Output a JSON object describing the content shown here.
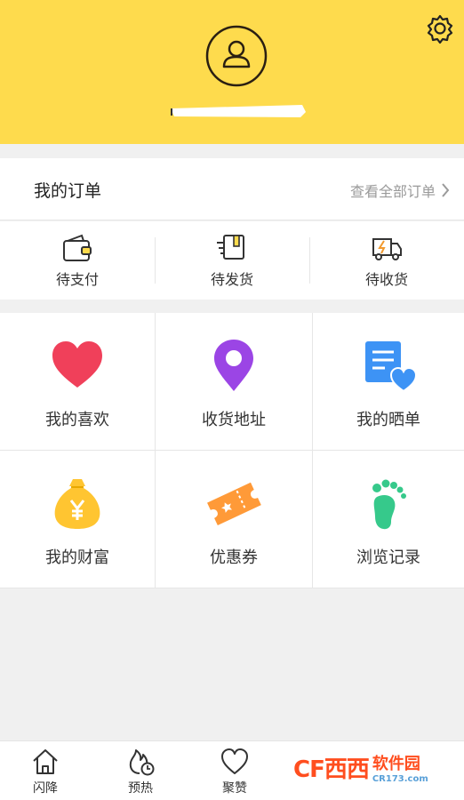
{
  "colors": {
    "header_bg": "#fedb4d",
    "heart": "#f0405a",
    "pin": "#9b45e5",
    "doc": "#3d93f5",
    "bag": "#ffc531",
    "ticket": "#ff9a38",
    "foot": "#36c98b",
    "watermark": "#ff4e1f"
  },
  "header": {
    "settings_icon": "gear-icon",
    "avatar_icon": "user-icon"
  },
  "orders": {
    "title": "我的订单",
    "view_all": "查看全部订单",
    "items": [
      {
        "label": "待支付",
        "icon": "wallet-icon"
      },
      {
        "label": "待发货",
        "icon": "package-icon"
      },
      {
        "label": "待收货",
        "icon": "truck-icon"
      }
    ]
  },
  "grid": [
    {
      "label": "我的喜欢",
      "icon": "heart-icon"
    },
    {
      "label": "收货地址",
      "icon": "location-pin-icon"
    },
    {
      "label": "我的晒单",
      "icon": "review-doc-icon"
    },
    {
      "label": "我的财富",
      "icon": "money-bag-icon"
    },
    {
      "label": "优惠券",
      "icon": "coupon-icon"
    },
    {
      "label": "浏览记录",
      "icon": "footprint-icon"
    }
  ],
  "tabs": [
    {
      "label": "闪降",
      "icon": "home-icon"
    },
    {
      "label": "预热",
      "icon": "flame-clock-icon"
    },
    {
      "label": "聚赞",
      "icon": "heart-outline-icon"
    }
  ],
  "watermark": {
    "logo": "CF西西",
    "name": "软件园",
    "url": "CR173.com"
  }
}
